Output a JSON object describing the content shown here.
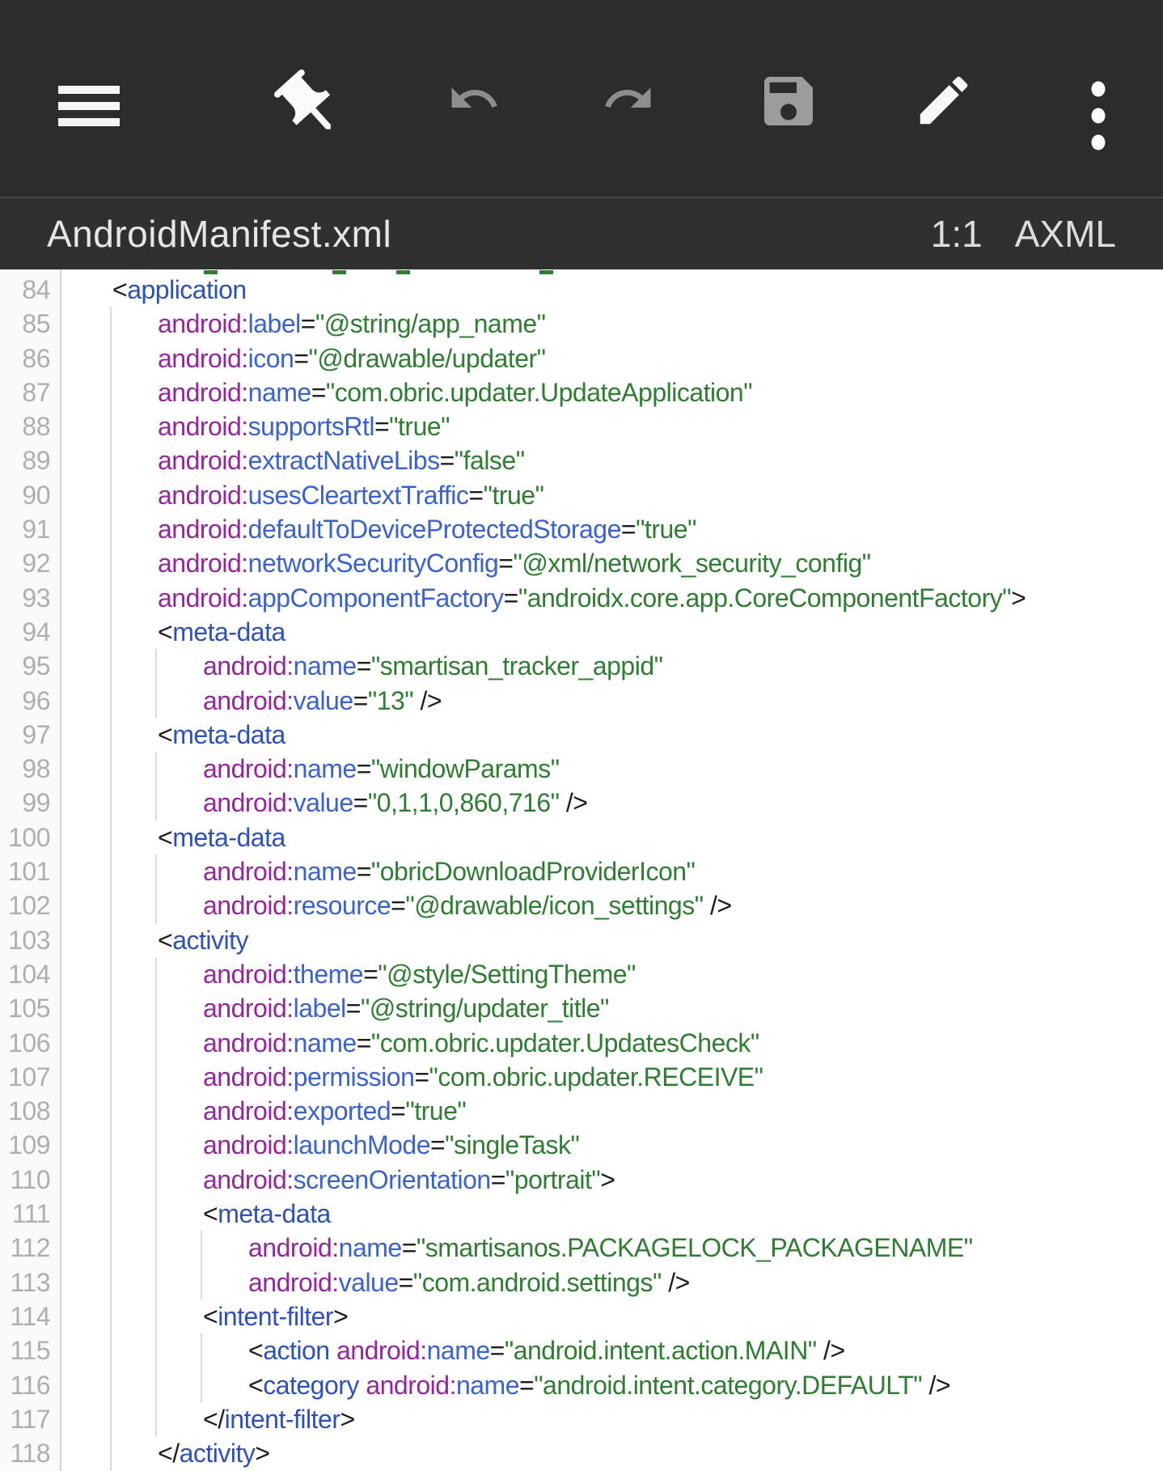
{
  "toolbar": {
    "icons": [
      "menu-icon",
      "pin-icon",
      "undo-icon",
      "redo-icon",
      "save-icon",
      "edit-icon",
      "overflow-icon"
    ]
  },
  "titlebar": {
    "filename": "AndroidManifest.xml",
    "cursor_position": "1:1",
    "file_type": "AXML"
  },
  "editor": {
    "colors": {
      "plain": "#1c1c1c",
      "tag": "#2d50ba",
      "ns": "#95259c",
      "attr": "#3a62cf",
      "str": "#2e7d32"
    },
    "clipped_line_dashes": [
      252,
      411,
      490,
      667
    ],
    "guides": [
      {
        "level": 1,
        "from": 85,
        "toEdge": true
      },
      {
        "level": 2,
        "from": 95,
        "to": 96
      },
      {
        "level": 2,
        "from": 98,
        "to": 99
      },
      {
        "level": 2,
        "from": 101,
        "to": 102
      },
      {
        "level": 2,
        "from": 104,
        "to": 117
      },
      {
        "level": 3,
        "from": 112,
        "to": 113
      },
      {
        "level": 3,
        "from": 115,
        "to": 116
      }
    ],
    "lines": [
      {
        "n": 84,
        "level": 1,
        "tokens": [
          [
            "p",
            "<"
          ],
          [
            "t",
            "application"
          ]
        ]
      },
      {
        "n": 85,
        "level": 2,
        "tokens": [
          [
            "n",
            "android:"
          ],
          [
            "a",
            "label"
          ],
          [
            "p",
            "="
          ],
          [
            "s",
            "\"@string/app_name\""
          ]
        ]
      },
      {
        "n": 86,
        "level": 2,
        "tokens": [
          [
            "n",
            "android:"
          ],
          [
            "a",
            "icon"
          ],
          [
            "p",
            "="
          ],
          [
            "s",
            "\"@drawable/updater\""
          ]
        ]
      },
      {
        "n": 87,
        "level": 2,
        "tokens": [
          [
            "n",
            "android:"
          ],
          [
            "a",
            "name"
          ],
          [
            "p",
            "="
          ],
          [
            "s",
            "\"com.obric.updater.UpdateApplication\""
          ]
        ]
      },
      {
        "n": 88,
        "level": 2,
        "tokens": [
          [
            "n",
            "android:"
          ],
          [
            "a",
            "supportsRtl"
          ],
          [
            "p",
            "="
          ],
          [
            "s",
            "\"true\""
          ]
        ]
      },
      {
        "n": 89,
        "level": 2,
        "tokens": [
          [
            "n",
            "android:"
          ],
          [
            "a",
            "extractNativeLibs"
          ],
          [
            "p",
            "="
          ],
          [
            "s",
            "\"false\""
          ]
        ]
      },
      {
        "n": 90,
        "level": 2,
        "tokens": [
          [
            "n",
            "android:"
          ],
          [
            "a",
            "usesCleartextTraffic"
          ],
          [
            "p",
            "="
          ],
          [
            "s",
            "\"true\""
          ]
        ]
      },
      {
        "n": 91,
        "level": 2,
        "tokens": [
          [
            "n",
            "android:"
          ],
          [
            "a",
            "defaultToDeviceProtectedStorage"
          ],
          [
            "p",
            "="
          ],
          [
            "s",
            "\"true\""
          ]
        ]
      },
      {
        "n": 92,
        "level": 2,
        "tokens": [
          [
            "n",
            "android:"
          ],
          [
            "a",
            "networkSecurityConfig"
          ],
          [
            "p",
            "="
          ],
          [
            "s",
            "\"@xml/network_security_config\""
          ]
        ]
      },
      {
        "n": 93,
        "level": 2,
        "tokens": [
          [
            "n",
            "android:"
          ],
          [
            "a",
            "appComponentFactory"
          ],
          [
            "p",
            "="
          ],
          [
            "s",
            "\"androidx.core.app.CoreComponentFactory\""
          ],
          [
            "p",
            ">"
          ]
        ]
      },
      {
        "n": 94,
        "level": 2,
        "tokens": [
          [
            "p",
            "<"
          ],
          [
            "t",
            "meta-data"
          ]
        ]
      },
      {
        "n": 95,
        "level": 3,
        "tokens": [
          [
            "n",
            "android:"
          ],
          [
            "a",
            "name"
          ],
          [
            "p",
            "="
          ],
          [
            "s",
            "\"smartisan_tracker_appid\""
          ]
        ]
      },
      {
        "n": 96,
        "level": 3,
        "tokens": [
          [
            "n",
            "android:"
          ],
          [
            "a",
            "value"
          ],
          [
            "p",
            "="
          ],
          [
            "s",
            "\"13\""
          ],
          [
            "p",
            " />"
          ]
        ]
      },
      {
        "n": 97,
        "level": 2,
        "tokens": [
          [
            "p",
            "<"
          ],
          [
            "t",
            "meta-data"
          ]
        ]
      },
      {
        "n": 98,
        "level": 3,
        "tokens": [
          [
            "n",
            "android:"
          ],
          [
            "a",
            "name"
          ],
          [
            "p",
            "="
          ],
          [
            "s",
            "\"windowParams\""
          ]
        ]
      },
      {
        "n": 99,
        "level": 3,
        "tokens": [
          [
            "n",
            "android:"
          ],
          [
            "a",
            "value"
          ],
          [
            "p",
            "="
          ],
          [
            "s",
            "\"0,1,1,0,860,716\""
          ],
          [
            "p",
            " />"
          ]
        ]
      },
      {
        "n": 100,
        "level": 2,
        "tokens": [
          [
            "p",
            "<"
          ],
          [
            "t",
            "meta-data"
          ]
        ]
      },
      {
        "n": 101,
        "level": 3,
        "tokens": [
          [
            "n",
            "android:"
          ],
          [
            "a",
            "name"
          ],
          [
            "p",
            "="
          ],
          [
            "s",
            "\"obricDownloadProviderIcon\""
          ]
        ]
      },
      {
        "n": 102,
        "level": 3,
        "tokens": [
          [
            "n",
            "android:"
          ],
          [
            "a",
            "resource"
          ],
          [
            "p",
            "="
          ],
          [
            "s",
            "\"@drawable/icon_settings\""
          ],
          [
            "p",
            " />"
          ]
        ]
      },
      {
        "n": 103,
        "level": 2,
        "tokens": [
          [
            "p",
            "<"
          ],
          [
            "t",
            "activity"
          ]
        ]
      },
      {
        "n": 104,
        "level": 3,
        "tokens": [
          [
            "n",
            "android:"
          ],
          [
            "a",
            "theme"
          ],
          [
            "p",
            "="
          ],
          [
            "s",
            "\"@style/SettingTheme\""
          ]
        ]
      },
      {
        "n": 105,
        "level": 3,
        "tokens": [
          [
            "n",
            "android:"
          ],
          [
            "a",
            "label"
          ],
          [
            "p",
            "="
          ],
          [
            "s",
            "\"@string/updater_title\""
          ]
        ]
      },
      {
        "n": 106,
        "level": 3,
        "tokens": [
          [
            "n",
            "android:"
          ],
          [
            "a",
            "name"
          ],
          [
            "p",
            "="
          ],
          [
            "s",
            "\"com.obric.updater.UpdatesCheck\""
          ]
        ]
      },
      {
        "n": 107,
        "level": 3,
        "tokens": [
          [
            "n",
            "android:"
          ],
          [
            "a",
            "permission"
          ],
          [
            "p",
            "="
          ],
          [
            "s",
            "\"com.obric.updater.RECEIVE\""
          ]
        ]
      },
      {
        "n": 108,
        "level": 3,
        "tokens": [
          [
            "n",
            "android:"
          ],
          [
            "a",
            "exported"
          ],
          [
            "p",
            "="
          ],
          [
            "s",
            "\"true\""
          ]
        ]
      },
      {
        "n": 109,
        "level": 3,
        "tokens": [
          [
            "n",
            "android:"
          ],
          [
            "a",
            "launchMode"
          ],
          [
            "p",
            "="
          ],
          [
            "s",
            "\"singleTask\""
          ]
        ]
      },
      {
        "n": 110,
        "level": 3,
        "tokens": [
          [
            "n",
            "android:"
          ],
          [
            "a",
            "screenOrientation"
          ],
          [
            "p",
            "="
          ],
          [
            "s",
            "\"portrait\""
          ],
          [
            "p",
            ">"
          ]
        ]
      },
      {
        "n": 111,
        "level": 3,
        "tokens": [
          [
            "p",
            "<"
          ],
          [
            "t",
            "meta-data"
          ]
        ]
      },
      {
        "n": 112,
        "level": 4,
        "tokens": [
          [
            "n",
            "android:"
          ],
          [
            "a",
            "name"
          ],
          [
            "p",
            "="
          ],
          [
            "s",
            "\"smartisanos.PACKAGELOCK_PACKAGENAME\""
          ]
        ]
      },
      {
        "n": 113,
        "level": 4,
        "tokens": [
          [
            "n",
            "android:"
          ],
          [
            "a",
            "value"
          ],
          [
            "p",
            "="
          ],
          [
            "s",
            "\"com.android.settings\""
          ],
          [
            "p",
            " />"
          ]
        ]
      },
      {
        "n": 114,
        "level": 3,
        "tokens": [
          [
            "p",
            "<"
          ],
          [
            "t",
            "intent-filter"
          ],
          [
            "p",
            ">"
          ]
        ]
      },
      {
        "n": 115,
        "level": 4,
        "tokens": [
          [
            "p",
            "<"
          ],
          [
            "t",
            "action"
          ],
          [
            "n",
            " android:"
          ],
          [
            "a",
            "name"
          ],
          [
            "p",
            "="
          ],
          [
            "s",
            "\"android.intent.action.MAIN\""
          ],
          [
            "p",
            " />"
          ]
        ]
      },
      {
        "n": 116,
        "level": 4,
        "tokens": [
          [
            "p",
            "<"
          ],
          [
            "t",
            "category"
          ],
          [
            "n",
            " android:"
          ],
          [
            "a",
            "name"
          ],
          [
            "p",
            "="
          ],
          [
            "s",
            "\"android.intent.category.DEFAULT\""
          ],
          [
            "p",
            " />"
          ]
        ]
      },
      {
        "n": 117,
        "level": 3,
        "tokens": [
          [
            "p",
            "</"
          ],
          [
            "t",
            "intent-filter"
          ],
          [
            "p",
            ">"
          ]
        ]
      },
      {
        "n": 118,
        "level": 2,
        "tokens": [
          [
            "p",
            "</"
          ],
          [
            "t",
            "activity"
          ],
          [
            "p",
            ">"
          ]
        ]
      }
    ]
  }
}
